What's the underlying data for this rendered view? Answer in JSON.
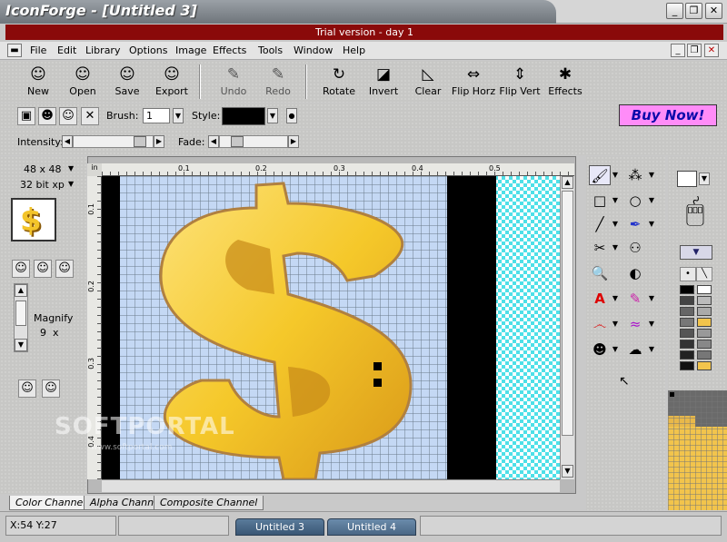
{
  "window": {
    "title": "IconForge - [Untitled  3]",
    "minimize": "_",
    "restore": "❐",
    "close": "✕"
  },
  "trial_banner": "Trial version - day 1",
  "menu": {
    "system_icon": "▬",
    "items": [
      "File",
      "Edit",
      "Library",
      "Options",
      "Image",
      "Effects",
      "Tools",
      "Window",
      "Help"
    ],
    "mdi_minimize": "_",
    "mdi_restore": "❐",
    "mdi_close": "✕"
  },
  "toolbar": {
    "buttons": [
      {
        "label": "New",
        "icon": "person-new-icon",
        "glyph": "☺"
      },
      {
        "label": "Open",
        "icon": "person-open-icon",
        "glyph": "☺"
      },
      {
        "label": "Save",
        "icon": "person-save-icon",
        "glyph": "☺"
      },
      {
        "label": "Export",
        "icon": "person-export-icon",
        "glyph": "☺"
      },
      {
        "label": "Undo",
        "icon": "undo-pen-icon",
        "glyph": "✎"
      },
      {
        "label": "Redo",
        "icon": "redo-pen-icon",
        "glyph": "✎"
      },
      {
        "label": "Rotate",
        "icon": "rotate-icon",
        "glyph": "↻"
      },
      {
        "label": "Invert",
        "icon": "invert-icon",
        "glyph": "◪"
      },
      {
        "label": "Clear",
        "icon": "clear-icon",
        "glyph": "◺"
      },
      {
        "label": "Flip Horz",
        "icon": "flip-horizontal-icon",
        "glyph": "⇔"
      },
      {
        "label": "Flip Vert",
        "icon": "flip-vertical-icon",
        "glyph": "⇕"
      },
      {
        "label": "Effects",
        "icon": "effects-icon",
        "glyph": "✱"
      }
    ]
  },
  "brush_bar": {
    "brush_label": "Brush:",
    "brush_value": "1",
    "style_label": "Style:",
    "buy_now": "Buy Now!"
  },
  "adjust_bar": {
    "intensity_label": "Intensity:",
    "intensity_value": 0.9,
    "fade_label": "Fade:",
    "fade_value": 0.2
  },
  "left_panel": {
    "size": "48 x 48",
    "depth": "32 bit xp",
    "magnify_label": "Magnify",
    "magnify_value": "9",
    "magnify_unit": "x"
  },
  "ruler": {
    "unit": "in",
    "h_ticks": [
      "0.1",
      "0.2",
      "0.3",
      "0.4",
      "0.5"
    ],
    "v_ticks": [
      "0.1",
      "0.2",
      "0.3",
      "0.4"
    ]
  },
  "channel_tabs": [
    "Color Channel",
    "Alpha Channel",
    "Composite Channel"
  ],
  "watermark": {
    "text": "SOFTPORTAL",
    "sub": "www.softportal.com"
  },
  "status": {
    "coords": "X:54 Y:27",
    "tasks": [
      "Untitled  3",
      "Untitled  4"
    ]
  },
  "colors": {
    "trial_bg": "#8a0a0a",
    "buy_now_bg": "#ff8cf8",
    "canvas_grid": "#c4d8f4",
    "coin_gold": "#f5c82a",
    "coin_shadow": "#c88a18"
  }
}
